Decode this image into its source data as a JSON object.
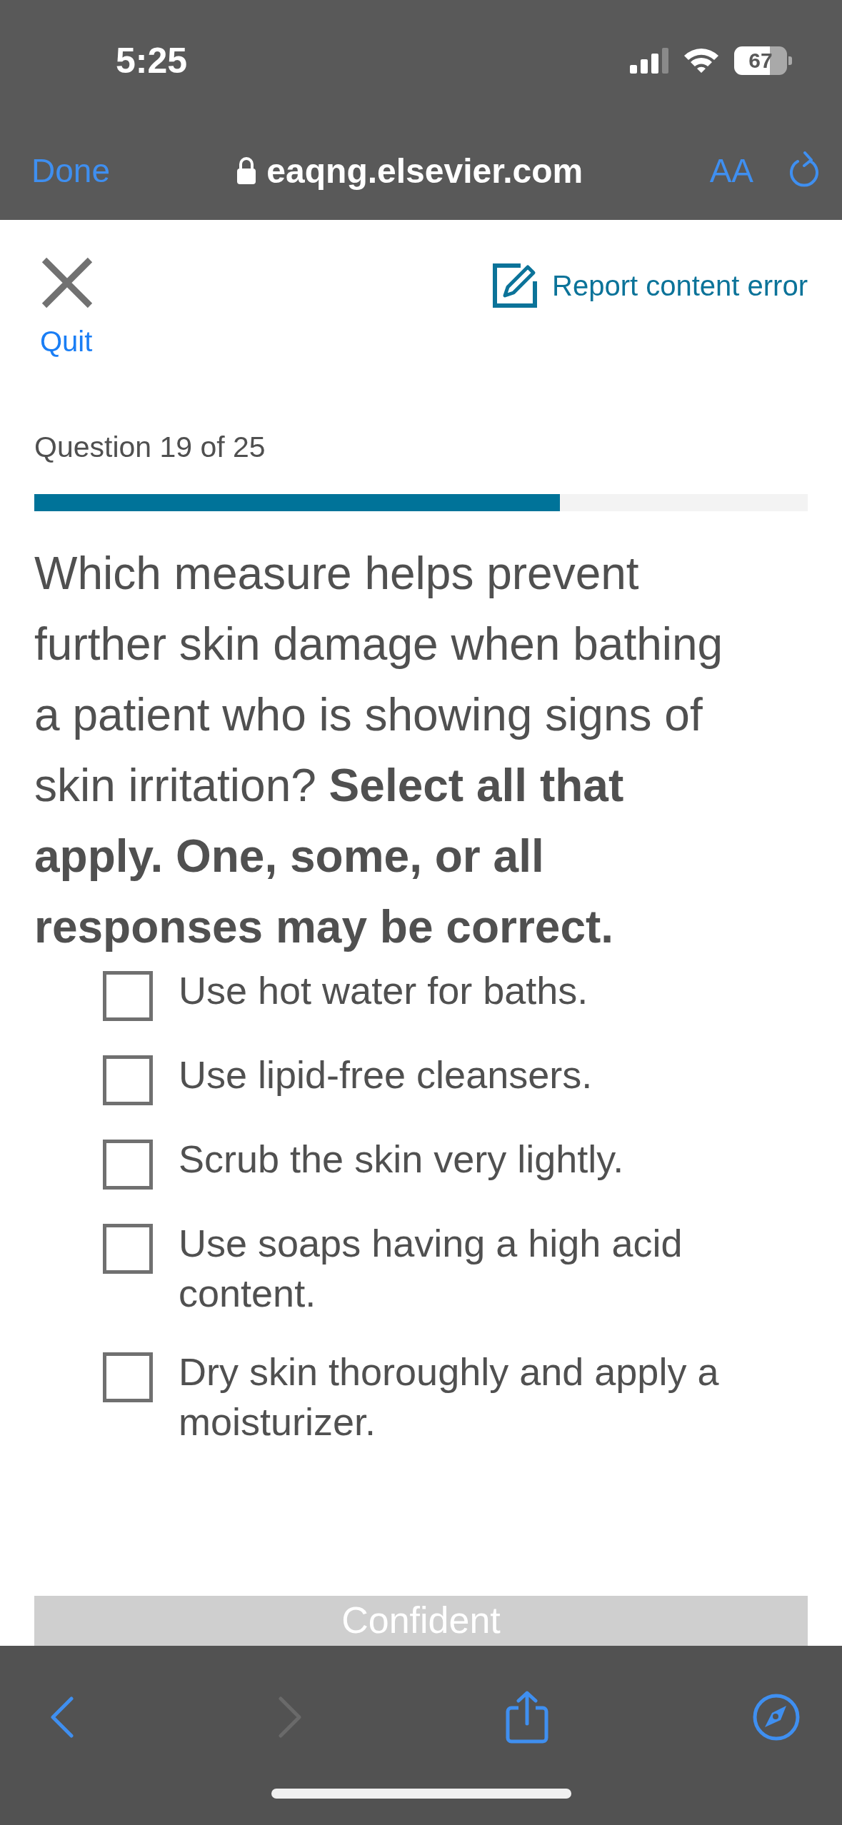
{
  "status_bar": {
    "time": "5:25",
    "battery": "67"
  },
  "browser": {
    "done": "Done",
    "url": "eaqng.elsevier.com",
    "text_size": "AA"
  },
  "quiz": {
    "quit": "Quit",
    "report": "Report content error",
    "counter": "Question 19 of 25",
    "progress": {
      "level": 0.68
    },
    "question": "Which measure helps prevent further skin damage when bathing a patient who is showing signs of skin irritation? **Select all that apply. One, some, or all responses may be correct.**",
    "options": [
      {
        "label": "Use hot water for baths.",
        "checked": false
      },
      {
        "label": "Use lipid-free cleansers.",
        "checked": false
      },
      {
        "label": "Scrub the skin very lightly.",
        "checked": false
      },
      {
        "label": "Use soaps having a high acid content.",
        "checked": false
      },
      {
        "label": "Dry skin thoroughly and apply a moisturizer.",
        "checked": false
      }
    ],
    "confident": "Confident"
  }
}
